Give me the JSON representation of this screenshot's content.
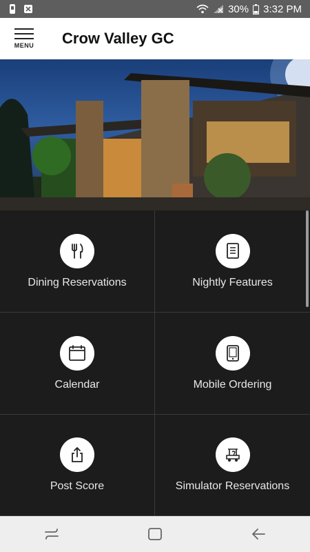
{
  "status": {
    "battery": "30%",
    "time": "3:32 PM"
  },
  "header": {
    "menu_label": "MENU",
    "title": "Crow Valley GC"
  },
  "tiles": [
    {
      "label": "Dining Reservations",
      "icon": "utensils-icon"
    },
    {
      "label": "Nightly Features",
      "icon": "document-icon"
    },
    {
      "label": "Calendar",
      "icon": "calendar-icon"
    },
    {
      "label": "Mobile Ordering",
      "icon": "tablet-icon"
    },
    {
      "label": "Post Score",
      "icon": "share-icon"
    },
    {
      "label": "Simulator Reservations",
      "icon": "golf-cart-icon"
    }
  ],
  "colors": {
    "status_bar": "#5e5e5e",
    "header_bg": "#ffffff",
    "tile_bg": "#1c1c1c",
    "nav_bar": "#eeeeee"
  }
}
